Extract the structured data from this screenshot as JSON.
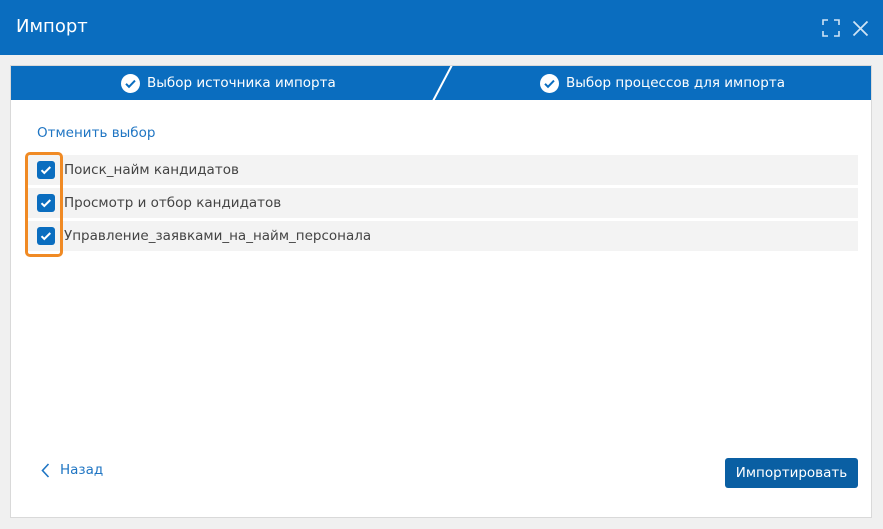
{
  "dialog": {
    "title": "Импорт",
    "icons": [
      "expand-icon",
      "close-icon"
    ]
  },
  "steps": [
    {
      "label": "Выбор источника импорта",
      "status": "completed"
    },
    {
      "label": "Выбор процессов для импорта",
      "status": "completed"
    }
  ],
  "selection": {
    "deselect_label": "Отменить выбор"
  },
  "processes": [
    {
      "label": "Поиск_найм кандидатов",
      "checked": true
    },
    {
      "label": "Просмотр и отбор кандидатов",
      "checked": true
    },
    {
      "label": "Управление_заявками_на_найм_персонала",
      "checked": true
    }
  ],
  "footer": {
    "back_label": "Назад",
    "import_label": "Импортировать"
  },
  "colors": {
    "accent": "#0a6dbf",
    "link": "#1f75c3",
    "highlight": "#f08a24"
  }
}
